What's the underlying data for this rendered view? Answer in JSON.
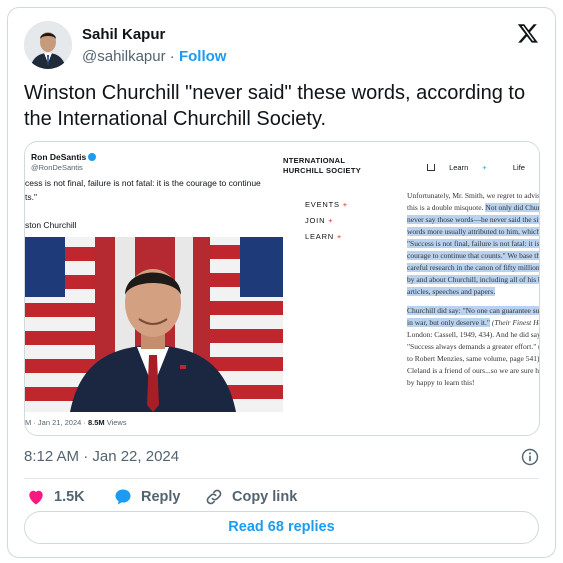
{
  "author": {
    "name": "Sahil Kapur",
    "handle": "@sahilkapur",
    "separator": "·",
    "follow_label": "Follow"
  },
  "tweet": {
    "text": "Winston Churchill \"never said\" these words, according to the International Churchill Society."
  },
  "media": {
    "quoted_tweet": {
      "name": "Ron DeSantis",
      "handle": "@RonDeSantis",
      "quote_lines": [
        "cess is not final, failure is not fatal: it is the courage to continue",
        "ts.\""
      ],
      "attribution": "ston Churchill",
      "date": "M · Jan 21, 2024 · ",
      "views_count": "8.5M",
      "views_label": " Views"
    },
    "ics_page": {
      "title_lines": [
        "NTERNATIONAL",
        "HURCHILL SOCIETY"
      ],
      "nav": [
        "Learn",
        "Life",
        "E"
      ],
      "menu": [
        "EVENTS",
        "JOIN",
        "LEARN"
      ],
      "paragraph1": [
        {
          "pre": "Unfortunately, Mr. Smith, we regret to advise",
          "hl": ""
        },
        {
          "pre": "this is a double misquote. ",
          "hl": "Not only did Church"
        },
        {
          "pre": "",
          "hl": "never say those words—he never said the simi"
        },
        {
          "pre": "",
          "hl": "words more usually attributed to him, which a"
        },
        {
          "pre": "",
          "hl": "\"Success is not final, failure is not fatal: it is th"
        },
        {
          "pre": "",
          "hl": "courage to continue that counts.\" We base thi"
        },
        {
          "pre": "",
          "hl": "careful research in the canon of fifty million w"
        },
        {
          "pre": "",
          "hl": "by and about Churchill, including all of his boo"
        },
        {
          "pre": "",
          "hl": "articles, speeches and papers."
        }
      ],
      "paragraph2": [
        {
          "pre": "",
          "hl": "Churchill did say: \"No one can guarantee succ"
        },
        {
          "pre": "",
          "hl": "in war, but only deserve it.\"",
          "post": " (Their Finest Hour"
        },
        {
          "pre": "London: Cassell, 1949, 434). And he did say:",
          "hl": ""
        },
        {
          "pre": "\"Success always demands a greater effort.\" (No",
          "hl": ""
        },
        {
          "pre": "to Robert Menzies, same volume, page 541). M",
          "hl": ""
        },
        {
          "pre": "Cleland is a friend of ours...so we are sure he w",
          "hl": ""
        },
        {
          "pre": "by happy to learn this!",
          "hl": ""
        }
      ]
    }
  },
  "timestamp": "8:12 AM · Jan 22, 2024",
  "actions": {
    "like_count": "1.5K",
    "reply_label": "Reply",
    "copy_link_label": "Copy link"
  },
  "read_replies_label": "Read 68 replies",
  "colors": {
    "accent": "#1d9bf0",
    "like": "#f91880",
    "highlight": "#b8d2f0",
    "ics_red": "#d12a2a"
  }
}
